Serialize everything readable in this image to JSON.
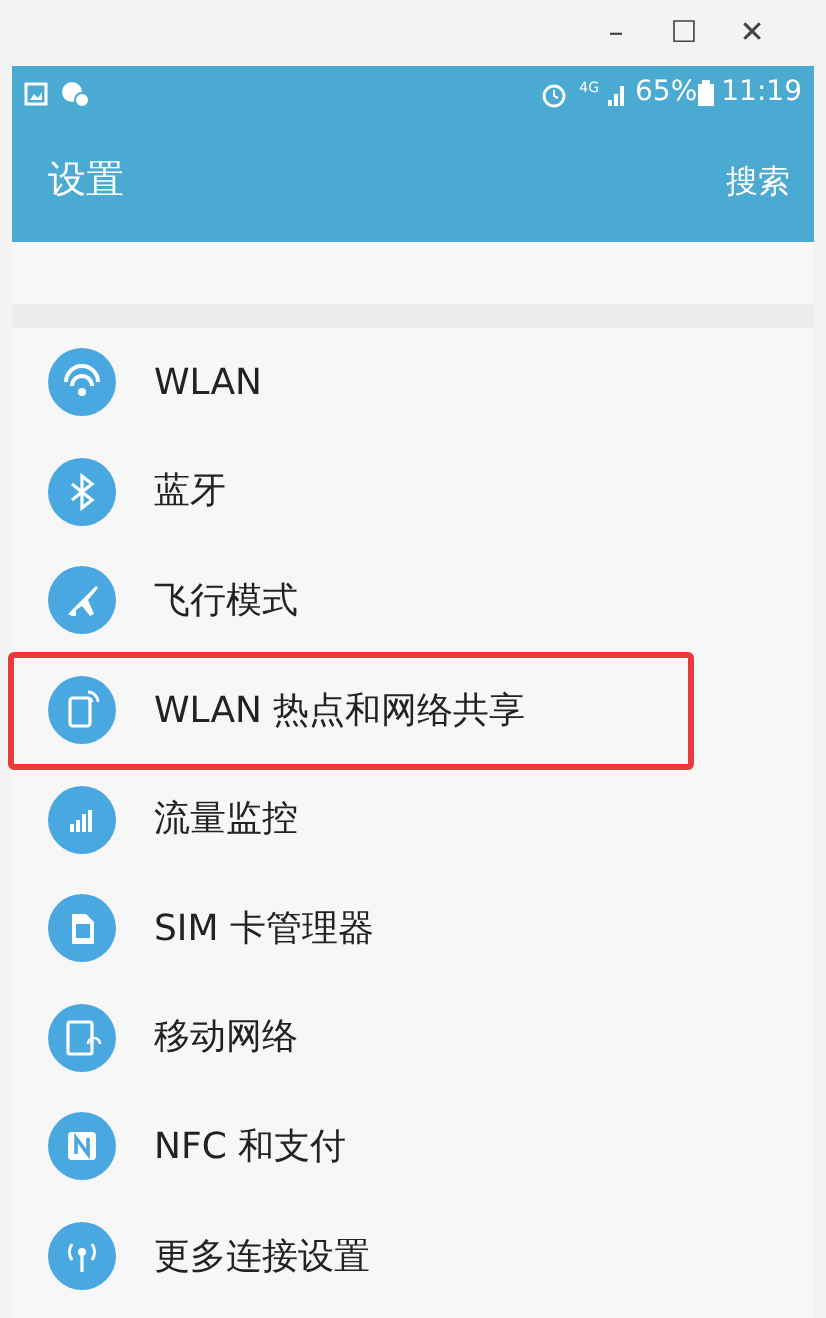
{
  "window": {
    "controls": [
      "–",
      "☐",
      "✕"
    ]
  },
  "status_bar": {
    "network": "4G",
    "battery": "65%",
    "time": "11:19"
  },
  "app_bar": {
    "title": "设置",
    "action": "搜索"
  },
  "items": [
    {
      "label": "WLAN",
      "highlighted": false
    },
    {
      "label": "蓝牙",
      "highlighted": false
    },
    {
      "label": "飞行模式",
      "highlighted": false
    },
    {
      "label": "WLAN 热点和网络共享",
      "highlighted": true
    },
    {
      "label": "流量监控",
      "highlighted": false
    },
    {
      "label": "SIM 卡管理器",
      "highlighted": false
    },
    {
      "label": "移动网络",
      "highlighted": false
    },
    {
      "label": "NFC 和支付",
      "highlighted": false
    },
    {
      "label": "更多连接设置",
      "highlighted": false
    }
  ]
}
